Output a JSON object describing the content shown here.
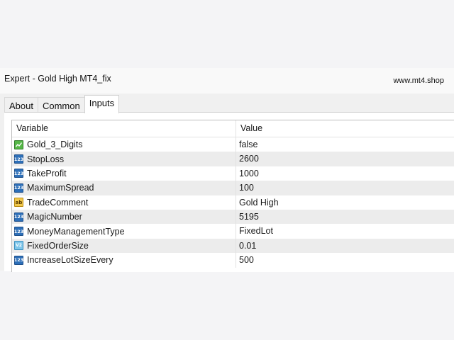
{
  "window": {
    "title": "Expert - Gold High MT4_fix",
    "watermark": "www.mt4.shop"
  },
  "tabs": [
    {
      "label": "About",
      "active": false
    },
    {
      "label": "Common",
      "active": false
    },
    {
      "label": "Inputs",
      "active": true
    }
  ],
  "table": {
    "headers": {
      "variable": "Variable",
      "value": "Value"
    },
    "rows": [
      {
        "icon": "bool-icon",
        "variable": "Gold_3_Digits",
        "value": "false"
      },
      {
        "icon": "integer-icon",
        "variable": "StopLoss",
        "value": "2600"
      },
      {
        "icon": "integer-icon",
        "variable": "TakeProfit",
        "value": "1000"
      },
      {
        "icon": "integer-icon",
        "variable": "MaximumSpread",
        "value": "100"
      },
      {
        "icon": "string-icon",
        "variable": "TradeComment",
        "value": "Gold High"
      },
      {
        "icon": "integer-icon",
        "variable": "MagicNumber",
        "value": "5195"
      },
      {
        "icon": "integer-icon",
        "variable": "MoneyManagementType",
        "value": "FixedLot"
      },
      {
        "icon": "double-icon",
        "variable": "FixedOrderSize",
        "value": "0.01"
      },
      {
        "icon": "integer-icon",
        "variable": "IncreaseLotSizeEvery",
        "value": "500"
      }
    ]
  },
  "icon_glyphs": {
    "integer": "123",
    "string": "ab",
    "double": "V2"
  },
  "colors": {
    "alt_row": "#ececec",
    "int_icon": "#2d6fb8",
    "bool_icon": "#55b747",
    "string_icon": "#f2c94c",
    "double_icon": "#7fc6ea"
  }
}
